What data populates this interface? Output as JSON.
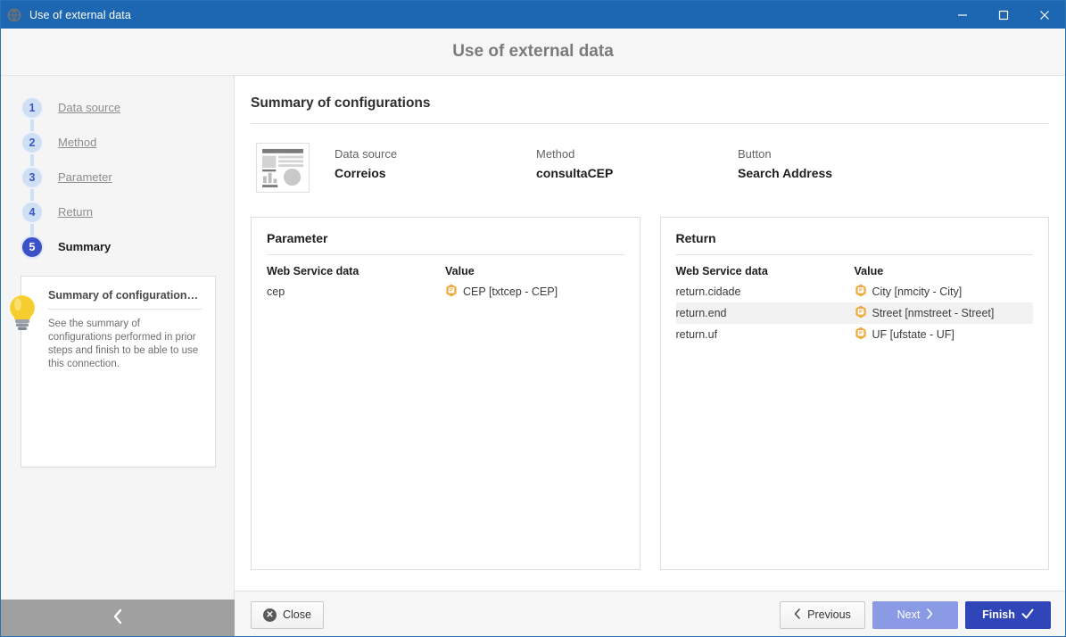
{
  "window": {
    "title": "Use of external data",
    "icon": "globe-icon",
    "controls": {
      "minimize": "–",
      "maximize": "□",
      "close": "✕"
    }
  },
  "modal": {
    "title": "Use of external data"
  },
  "sidebar": {
    "steps": [
      {
        "number": "1",
        "label": "Data source",
        "state": "done"
      },
      {
        "number": "2",
        "label": "Method",
        "state": "done"
      },
      {
        "number": "3",
        "label": "Parameter",
        "state": "done"
      },
      {
        "number": "4",
        "label": "Return",
        "state": "done"
      },
      {
        "number": "5",
        "label": "Summary",
        "state": "active"
      }
    ],
    "hint": {
      "icon": "lightbulb-icon",
      "title": "Summary of configurations p...",
      "text": "See the summary of configurations performed in prior steps and finish to be able to use this connection."
    },
    "collapse": {
      "icon": "chevron-left-icon"
    }
  },
  "main": {
    "title": "Summary of configurations",
    "overview": {
      "thumbnail_icon": "report-thumbnail-icon",
      "fields": [
        {
          "label": "Data source",
          "value": "Correios"
        },
        {
          "label": "Method",
          "value": "consultaCEP"
        },
        {
          "label": "Button",
          "value": "Search Address"
        }
      ]
    },
    "panels": [
      {
        "title": "Parameter",
        "columns": [
          "Web Service data",
          "Value"
        ],
        "rows": [
          {
            "data": "cep",
            "value": "CEP [txtcep - CEP]",
            "icon": "field-hex-icon",
            "highlighted": false
          }
        ]
      },
      {
        "title": "Return",
        "columns": [
          "Web Service data",
          "Value"
        ],
        "rows": [
          {
            "data": "return.cidade",
            "value": "City [nmcity - City]",
            "icon": "field-hex-icon",
            "highlighted": false
          },
          {
            "data": "return.end",
            "value": "Street [nmstreet - Street]",
            "icon": "field-hex-icon",
            "highlighted": true
          },
          {
            "data": "return.uf",
            "value": "UF [ufstate - UF]",
            "icon": "field-hex-icon",
            "highlighted": false
          }
        ]
      }
    ]
  },
  "footer": {
    "close": {
      "label": "Close",
      "icon": "close-circle-icon"
    },
    "previous": {
      "label": "Previous",
      "icon": "chevron-left-icon"
    },
    "next": {
      "label": "Next",
      "icon": "chevron-right-icon"
    },
    "finish": {
      "label": "Finish",
      "icon": "check-icon"
    }
  },
  "colors": {
    "titlebar": "#1d66b2",
    "accent": "#2f45b8",
    "step_done": "#cfe0f5",
    "step_active": "#3a51c7",
    "next_disabled": "#8b9ae4",
    "hex_icon": "#efa83a",
    "row_highlight": "#f2f2f2"
  }
}
